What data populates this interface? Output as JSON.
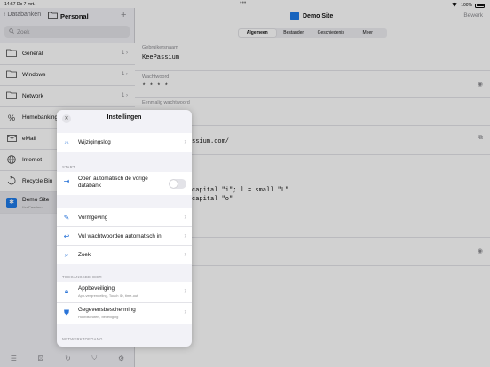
{
  "status": {
    "time": "14:57",
    "date": "Do 7 mrt.",
    "battery": "100%"
  },
  "sidebar": {
    "back_label": "Databanken",
    "title": "Personal",
    "search_placeholder": "Zoek",
    "items": [
      {
        "label": "General",
        "count": "1",
        "icon": "folder-icon"
      },
      {
        "label": "Windows",
        "count": "1",
        "icon": "folder-icon"
      },
      {
        "label": "Network",
        "count": "1",
        "icon": "folder-icon"
      },
      {
        "label": "Homebanking",
        "count": "",
        "icon": "percent-icon"
      },
      {
        "label": "eMail",
        "count": "",
        "icon": "envelope-icon"
      },
      {
        "label": "Internet",
        "count": "",
        "icon": "globe-icon"
      },
      {
        "label": "Recycle Bin",
        "count": "",
        "icon": "recycle-icon"
      },
      {
        "label": "Demo Site",
        "subtitle": "KeePassium",
        "icon": "keepassium-icon"
      }
    ]
  },
  "main": {
    "title": "Demo Site",
    "edit_label": "Bewerk",
    "tabs": [
      "Algemeen",
      "Bestanden",
      "Geschiedenis",
      "Meer"
    ],
    "active_tab": "Algemeen",
    "fields": {
      "username_label": "Gebruikersnaam",
      "username": "KeePassium",
      "password_label": "Wachtwoord",
      "password": "* * * *",
      "otp_label": "Eenmalig wachtwoord",
      "url_fragment": "ssium.com/",
      "notes_line1": "capital \"i\"; l = small \"L\"",
      "notes_line2": "capital \"o\""
    }
  },
  "settings": {
    "title": "Instellingen",
    "changelog": "Wijzigingslog",
    "section_start": "START",
    "open_auto": "Open automatisch de vorige databank",
    "open_auto_on": false,
    "appearance": "Vormgeving",
    "autofill": "Vul wachtwoorden automatisch in",
    "search": "Zoek",
    "section_access": "TOEGANGSBEHEER",
    "app_protection": "Appbeveiliging",
    "app_protection_sub": "App-vergrendeling, Touch ID, time-out",
    "data_protection": "Gegevensbescherming",
    "data_protection_sub": "Hoofdsleutels, beveiliging",
    "section_network": "NETWERKTOEGANG"
  }
}
